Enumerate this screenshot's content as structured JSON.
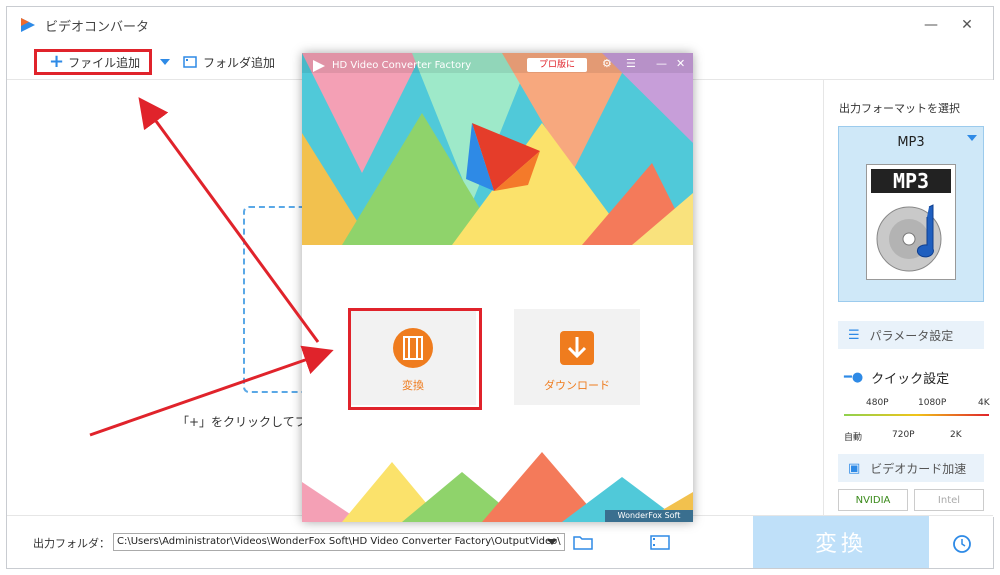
{
  "window": {
    "title": "ビデオコンバータ",
    "minimize": "—",
    "close": "✕"
  },
  "toolbar": {
    "add_file": "ファイル追加",
    "add_folder": "フォルダ追加"
  },
  "main": {
    "hint": "「+」をクリックしてファ"
  },
  "right_panel": {
    "format_label": "出力フォーマットを選択",
    "format_name": "MP3",
    "format_badge": "MP3",
    "param_btn": "パラメータ設定",
    "quick_label": "クイック設定",
    "slider_top": [
      "480P",
      "1080P",
      "4K"
    ],
    "slider_bottom": [
      "自動",
      "720P",
      "2K"
    ],
    "gpu_btn": "ビデオカード加速",
    "nvidia": "NVIDIA",
    "intel": "Intel"
  },
  "bottom": {
    "output_label": "出力フォルダ：",
    "output_path": "C:\\Users\\Administrator\\Videos\\WonderFox Soft\\HD Video Converter Factory\\OutputVideo\\",
    "convert": "変換"
  },
  "popup": {
    "title": "HD Video Converter Factory",
    "pro": "プロ版に",
    "convert": "変換",
    "download": "ダウンロード",
    "brand": "WonderFox Soft"
  },
  "colors": {
    "accent": "#2e8ae6",
    "orange": "#ef7c1e",
    "highlight": "#e0232b"
  }
}
